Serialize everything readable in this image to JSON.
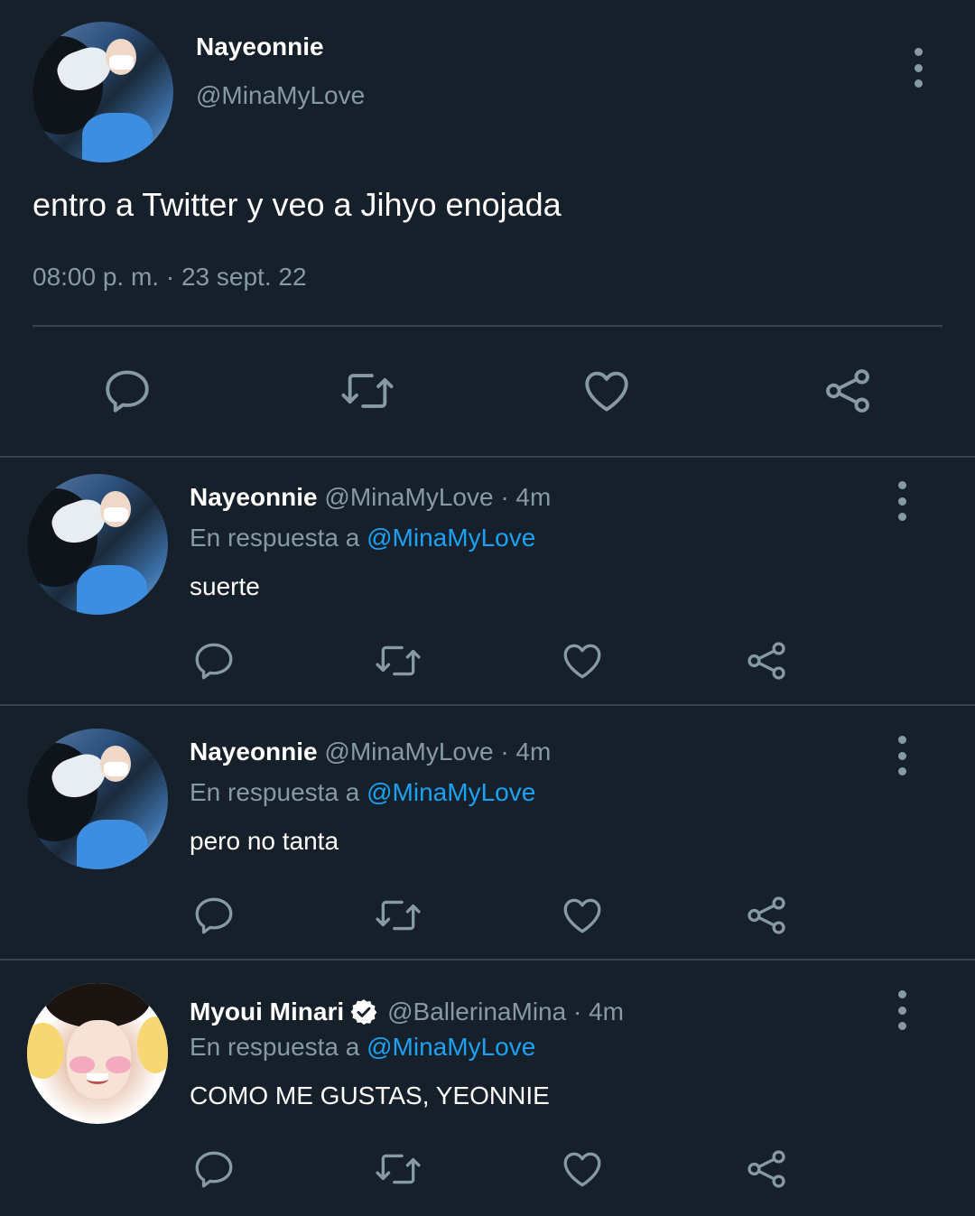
{
  "main_tweet": {
    "display_name": "Nayeonnie",
    "handle": "@MinaMyLove",
    "text": "entro a Twitter y veo a Jihyo enojada",
    "timestamp": "08:00 p. m. · 23 sept. 22"
  },
  "replies": [
    {
      "display_name": "Nayeonnie",
      "handle": "@MinaMyLove · 4m",
      "reply_prefix": "En respuesta a",
      "reply_to": "@MinaMyLove",
      "text": "suerte"
    },
    {
      "display_name": "Nayeonnie",
      "handle": "@MinaMyLove · 4m",
      "reply_prefix": "En respuesta a",
      "reply_to": "@MinaMyLove",
      "text": "pero no tanta"
    },
    {
      "display_name": "Myoui Minari",
      "handle": "@BallerinaMina · 4m",
      "reply_prefix": "En respuesta a",
      "reply_to": "@MinaMyLove",
      "text": "COMO ME GUSTAS, YEONNIE",
      "verified": true
    }
  ],
  "icons": {
    "reply": "reply-bubble-icon",
    "retweet": "retweet-icon",
    "like": "heart-icon",
    "share": "share-icon",
    "more": "more-vertical-icon",
    "verified": "verified-badge-icon"
  },
  "colors": {
    "background": "#15202b",
    "divider": "#38444d",
    "muted_text": "#8899a6",
    "link": "#1da1f2",
    "icon": "#8899a6"
  }
}
